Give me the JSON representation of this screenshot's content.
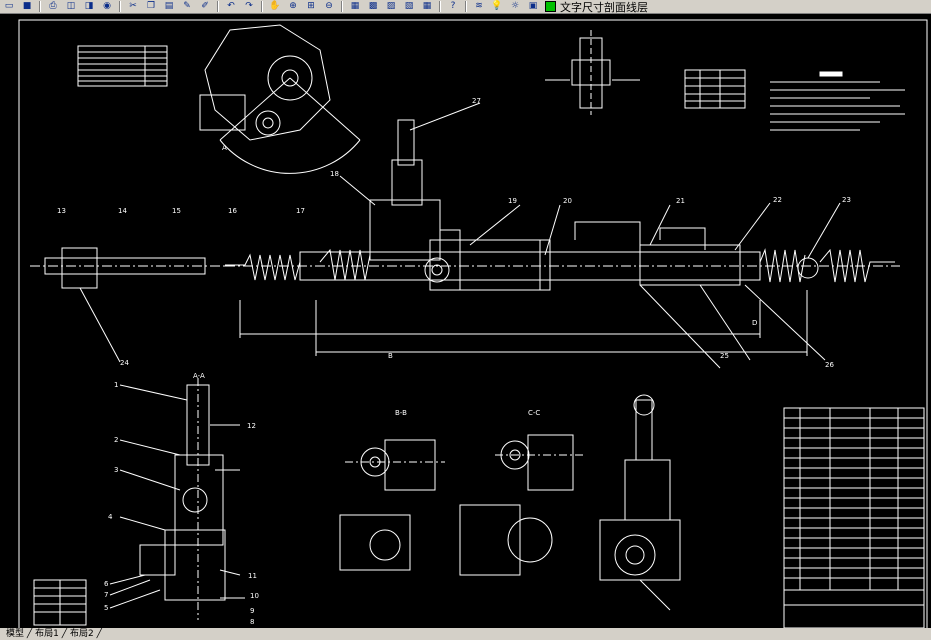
{
  "toolbar": {
    "icons": [
      "open-icon",
      "save-icon",
      "print-icon",
      "preview-icon",
      "publish-icon",
      "cut-icon",
      "copy-icon",
      "paste-icon",
      "match-prop-icon",
      "undo-icon",
      "redo-icon",
      "pan-icon",
      "zoom-realtime-icon",
      "zoom-window-icon",
      "zoom-previous-icon",
      "properties-icon",
      "design-center-icon",
      "tool-palette-icon",
      "sheet-set-icon",
      "markup-icon",
      "calc-icon",
      "help-icon",
      "layer-icon"
    ],
    "layer_name": "文字尺寸剖面线层",
    "layer_color": "#00c000",
    "accent": "#0a2d8a"
  },
  "drawing": {
    "background": "#000000",
    "line_color": "#ffffff",
    "balloons": [
      "1",
      "2",
      "3",
      "4",
      "5",
      "6",
      "7",
      "8",
      "9",
      "10",
      "11",
      "12",
      "13",
      "14",
      "15",
      "16",
      "17",
      "18",
      "19",
      "20",
      "21",
      "22",
      "23",
      "24",
      "25",
      "26",
      "27"
    ],
    "section_labels": [
      "A-A",
      "B-B",
      "C-C",
      "A",
      "B",
      "C",
      "D"
    ]
  },
  "status_bar": {
    "text": "模型 ╱ 布局1 ╱ 布局2 ╱"
  }
}
